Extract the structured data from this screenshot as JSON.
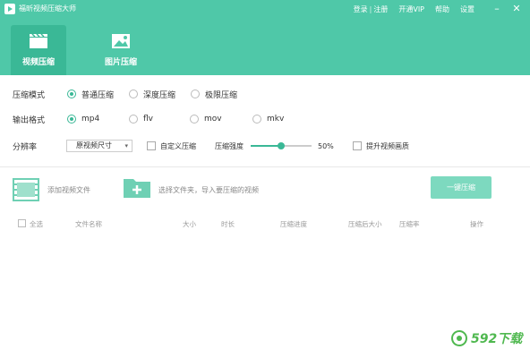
{
  "app": {
    "title": "福昕视频压缩大师"
  },
  "top_menu": {
    "login": "登录",
    "register": "注册",
    "vip": "开通VIP",
    "help": "帮助",
    "settings": "设置"
  },
  "tabs": [
    {
      "label": "视频压缩",
      "active": true
    },
    {
      "label": "图片压缩",
      "active": false
    }
  ],
  "mode": {
    "label": "压缩模式",
    "options": [
      "普通压缩",
      "深度压缩",
      "极限压缩"
    ],
    "selected": "普通压缩"
  },
  "format": {
    "label": "输出格式",
    "options": [
      "mp4",
      "flv",
      "mov",
      "mkv"
    ],
    "selected": "mp4"
  },
  "resolution": {
    "label": "分辨率",
    "value": "原视频尺寸",
    "custom_label": "自定义压缩",
    "strength_label": "压缩强度",
    "strength_value": "50%",
    "strength_fraction": 0.5,
    "enhance_label": "提升视频画质"
  },
  "actions": {
    "add_video": "添加视频文件",
    "add_folder": "选择文件夹，导入要压缩的视频",
    "compress": "一键压缩"
  },
  "table": {
    "headers": [
      "全选",
      "文件名称",
      "大小",
      "时长",
      "压缩进度",
      "压缩后大小",
      "压缩率",
      "操作"
    ]
  },
  "watermark": {
    "text": "592下载"
  },
  "colors": {
    "accent": "#4fc8a8",
    "accent_dark": "#3ab896",
    "button": "#7dd9bf"
  }
}
